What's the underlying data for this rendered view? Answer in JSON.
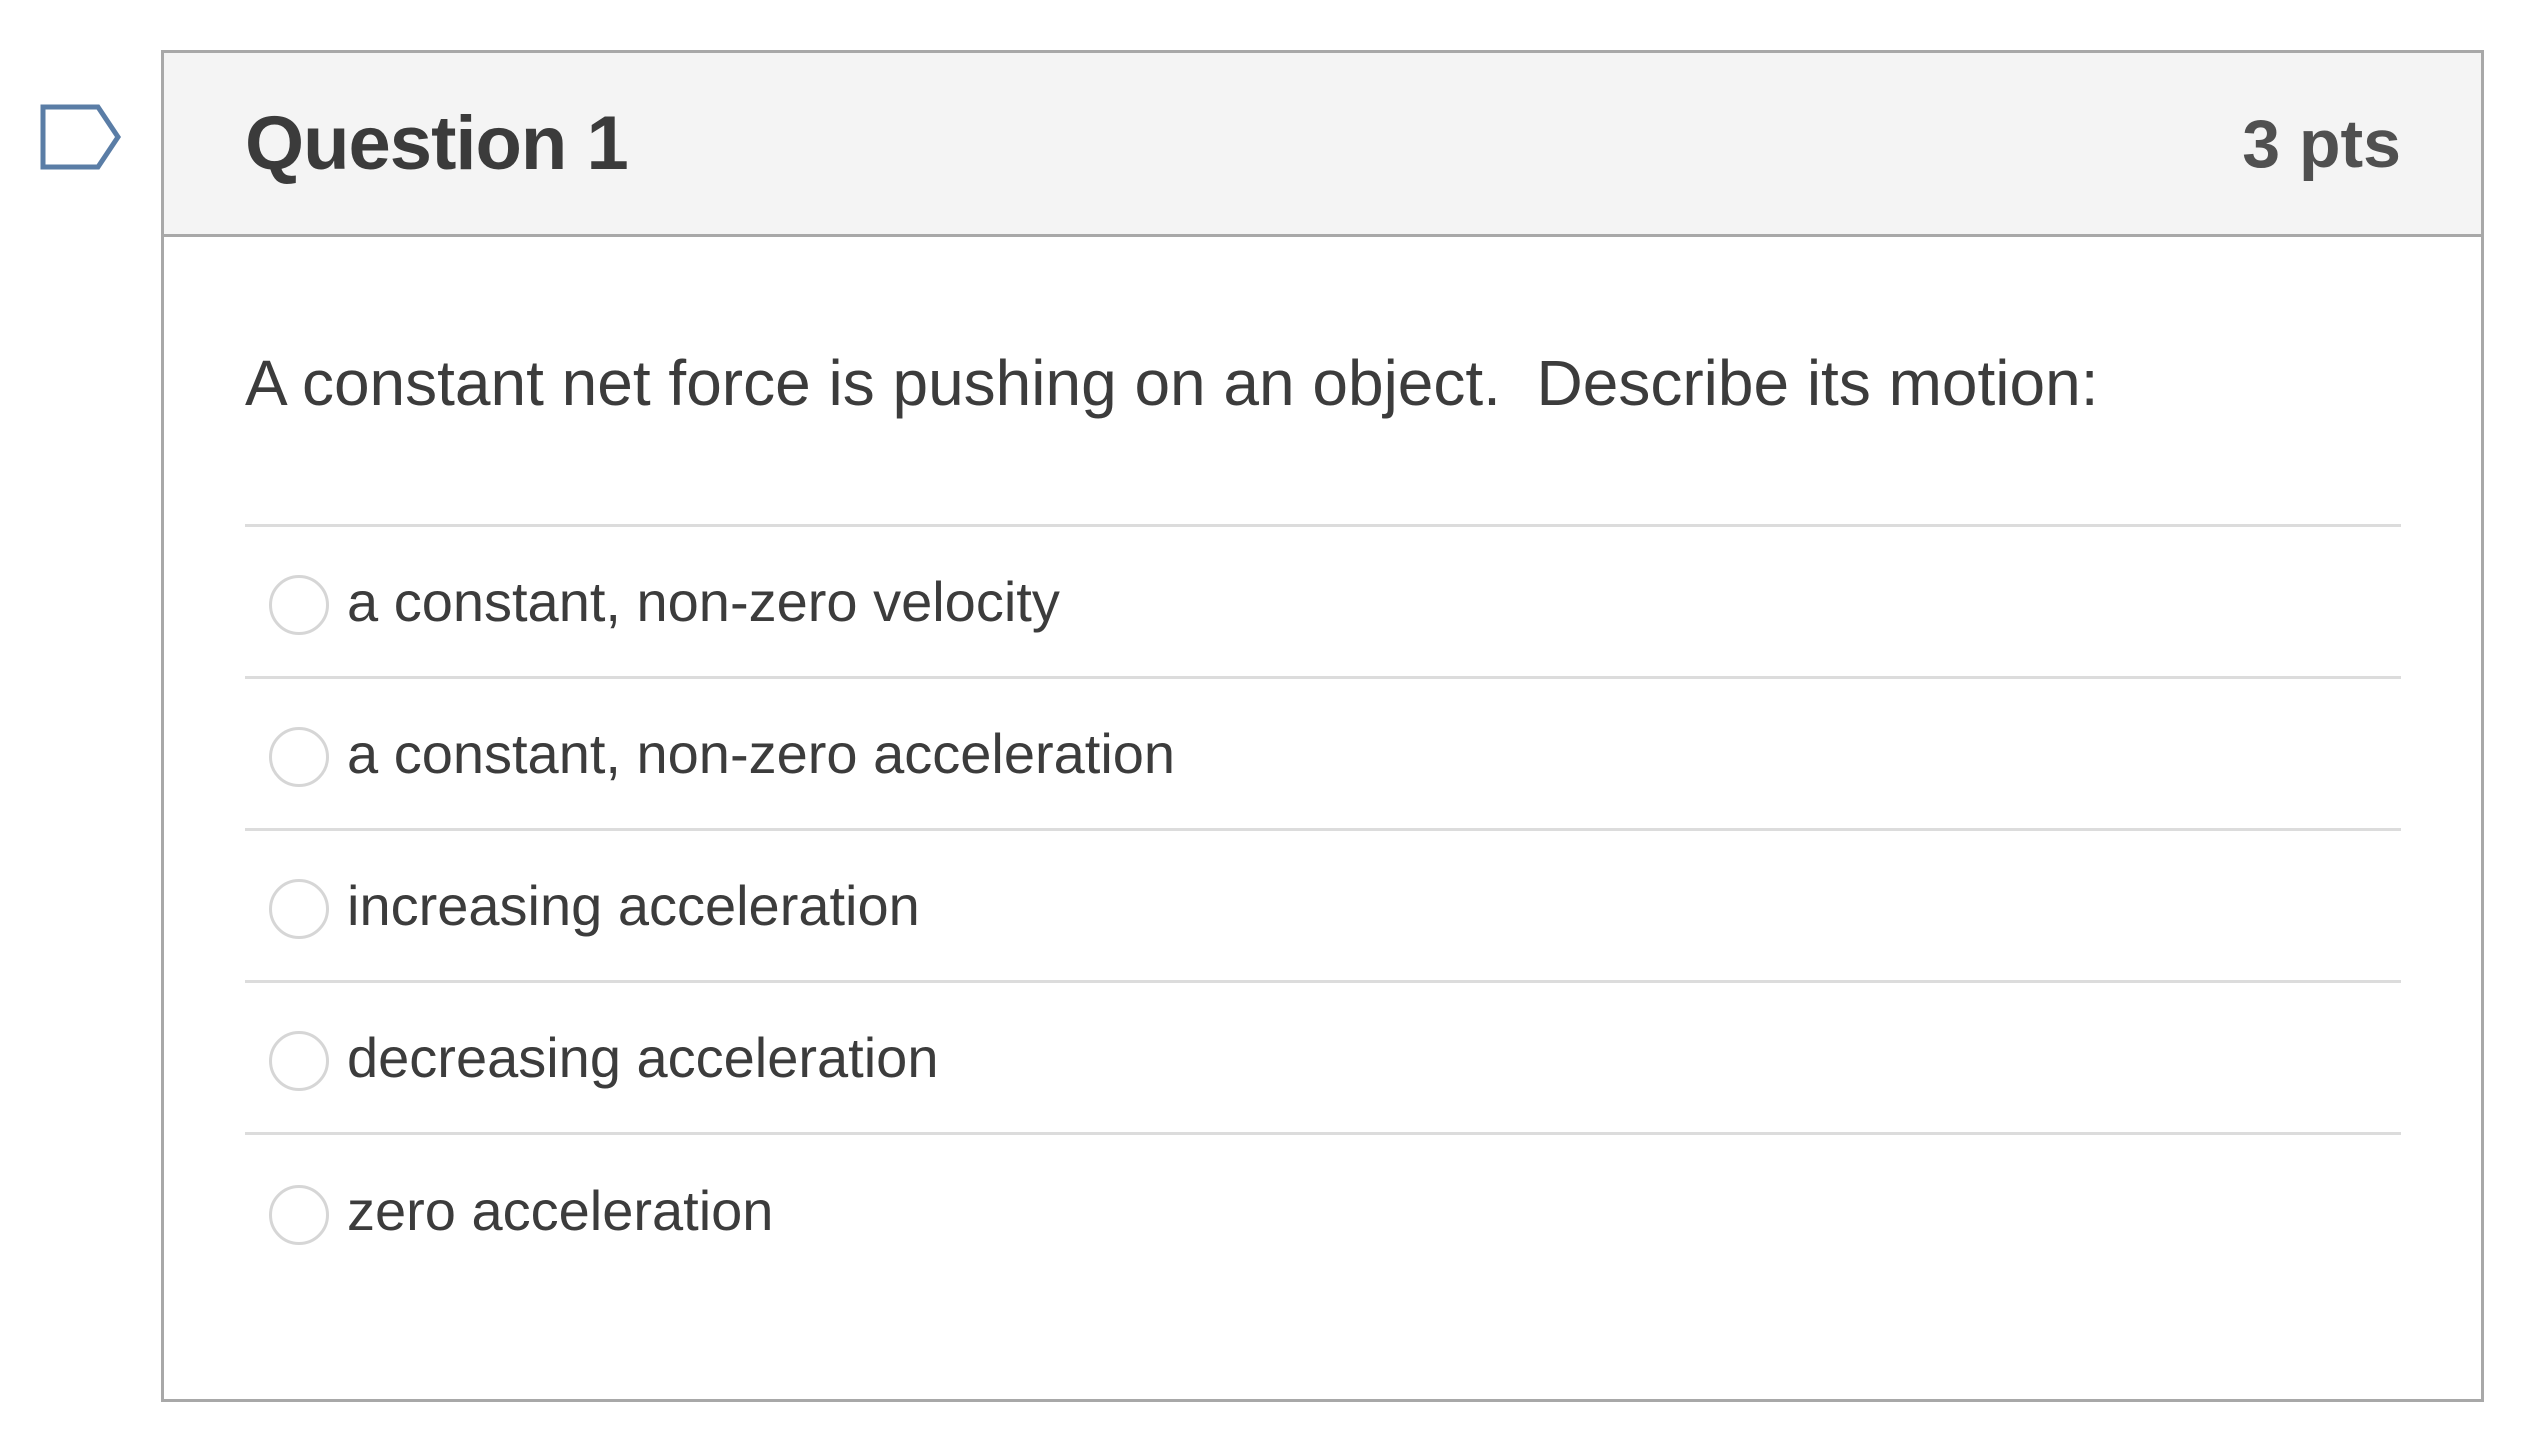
{
  "question": {
    "title": "Question 1",
    "points": "3 pts",
    "text": "A constant net force is pushing on an object.  Describe its motion:",
    "answers": [
      {
        "label": "a constant, non-zero velocity",
        "selected": false
      },
      {
        "label": "a constant, non-zero acceleration",
        "selected": false
      },
      {
        "label": "increasing acceleration",
        "selected": false
      },
      {
        "label": "decreasing acceleration",
        "selected": false
      },
      {
        "label": "zero acceleration",
        "selected": false
      }
    ]
  },
  "colors": {
    "header_bg": "#f4f4f4",
    "border": "#a8a8a8",
    "divider": "#dcdcdc",
    "flag_stroke": "#5a7da6"
  },
  "icons": {
    "flag": "flag-bookmark-icon"
  }
}
